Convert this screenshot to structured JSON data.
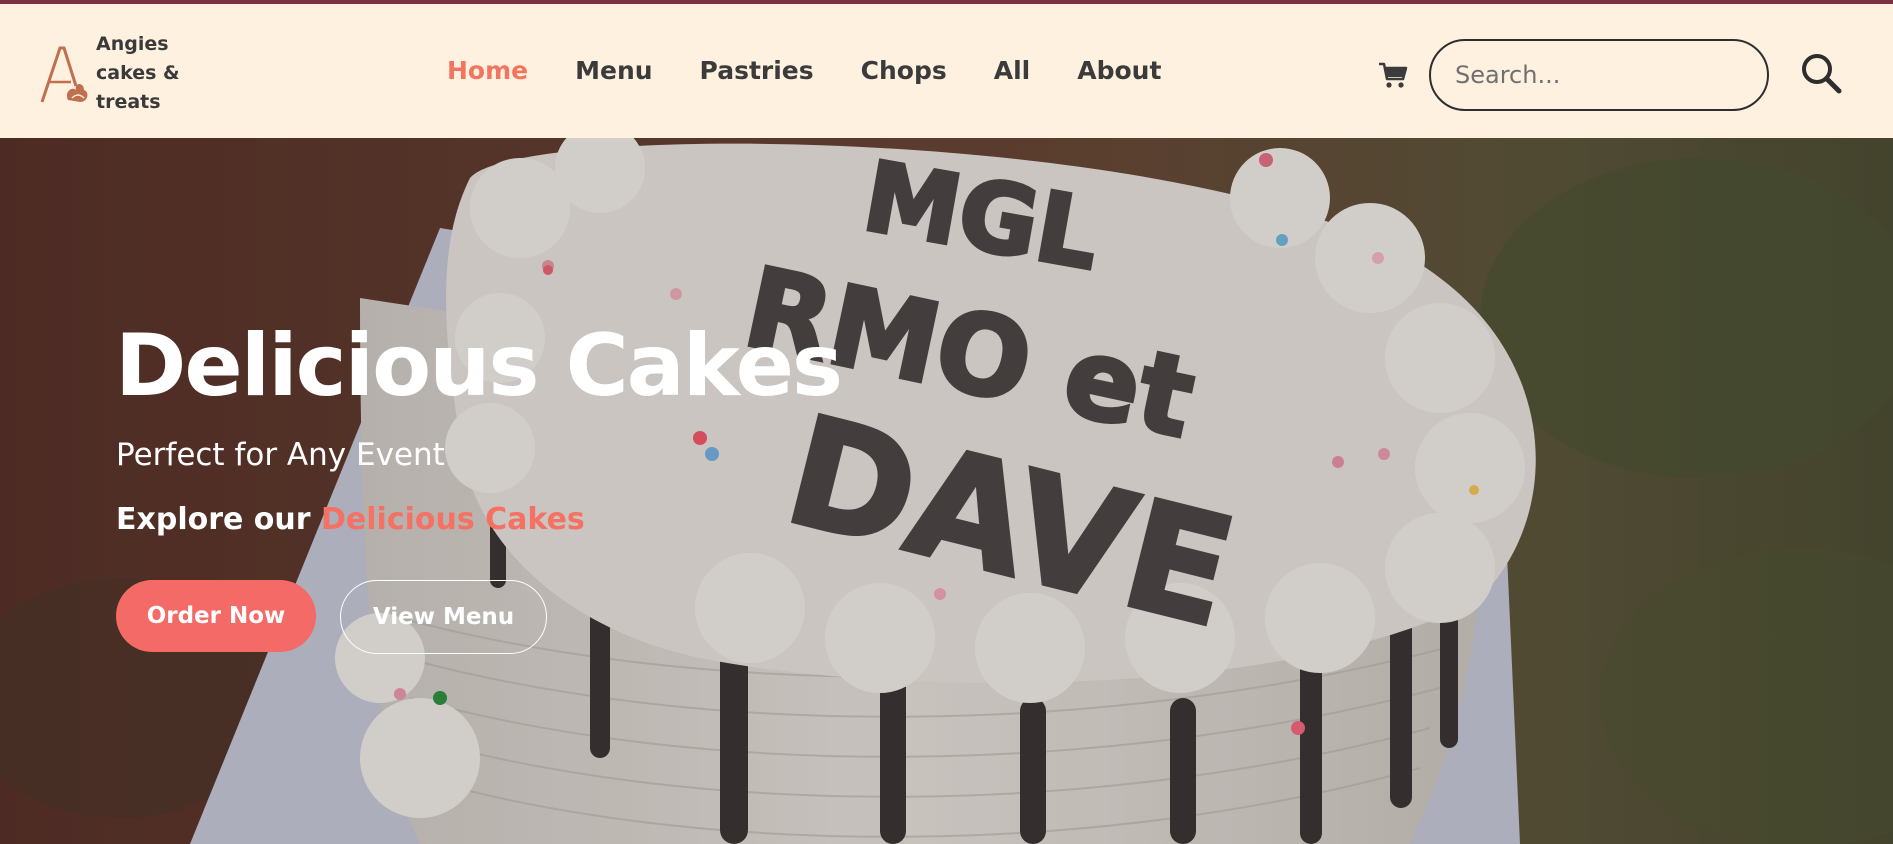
{
  "brand": {
    "logo_letter": "A",
    "name": "Angies cakes & treats",
    "name_lines": [
      "Angies",
      "cakes &",
      "treats"
    ]
  },
  "nav": {
    "items": [
      {
        "label": "Home",
        "active": true
      },
      {
        "label": "Menu",
        "active": false
      },
      {
        "label": "Pastries",
        "active": false
      },
      {
        "label": "Chops",
        "active": false
      },
      {
        "label": "All",
        "active": false
      },
      {
        "label": "About",
        "active": false
      }
    ]
  },
  "header_actions": {
    "cart_icon": "cart-icon",
    "search_placeholder": "Search...",
    "search_value": "",
    "search_icon": "search-icon"
  },
  "hero": {
    "title": "Delicious Cakes",
    "subtitle": "Perfect for Any Event",
    "explore_prefix": "Explore our ",
    "explore_highlight": "Delicious Cakes",
    "order_button": "Order Now",
    "menu_button": "View Menu",
    "cake_lettering": [
      "MGL",
      "RMO et",
      "DAVE"
    ]
  },
  "colors": {
    "accent": "#f46a66",
    "active_nav": "#f2765f",
    "header_bg": "#fff1df",
    "top_line": "#7c2f45",
    "logo": "#c0704f"
  }
}
